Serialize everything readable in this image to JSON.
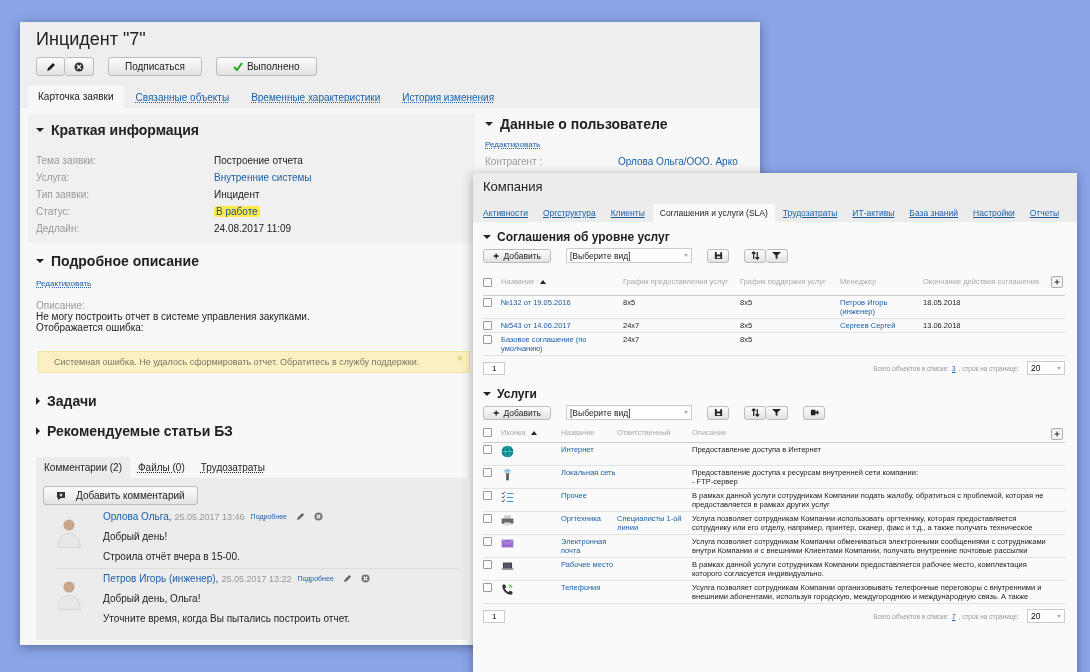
{
  "incident": {
    "title": "Инцидент \"7\"",
    "actions": [
      {
        "label": "Подписаться",
        "kind": "plain"
      },
      {
        "label": "Выполнено",
        "kind": "done"
      }
    ],
    "tabs": [
      {
        "label": "Карточка заявки",
        "selected": true
      },
      {
        "label": "Связанные объекты",
        "selected": false
      },
      {
        "label": "Временные характеристики",
        "selected": false
      },
      {
        "label": "История изменения",
        "selected": false
      }
    ],
    "summary": {
      "title": "Краткая информация",
      "expanded": true,
      "fields": [
        {
          "label": "Тема заявки:",
          "value": "Построение отчета",
          "kind": "text"
        },
        {
          "label": "Услуга:",
          "value": "Внутренние системы",
          "kind": "link"
        },
        {
          "label": "Тип заявки:",
          "value": "Инцидент",
          "kind": "text"
        },
        {
          "label": "Статус:",
          "value": "В работе",
          "kind": "badge"
        },
        {
          "label": "Дедлайн:",
          "value": "24.08.2017 11:09",
          "kind": "text"
        }
      ]
    },
    "user_data": {
      "title": "Данные о пользователе",
      "expanded": true,
      "edit_link": "Редактировать",
      "fields": [
        {
          "label": "Контрагент :",
          "value": "Орлова Ольга/ООО. Арко"
        }
      ]
    },
    "description": {
      "title": "Подробное описание",
      "expanded": true,
      "edit_link": "Редактировать",
      "label": "Описание:",
      "lines": [
        "Не могу построить отчет в системе управления закупками.",
        "Отображается ошибка:"
      ],
      "alert": "Системная ошибка. Не удалось сформировать отчет. Обратитесь в службу поддержки.",
      "alert_close": "×"
    },
    "sections": [
      {
        "title": "Задачи",
        "expanded": false
      },
      {
        "title": "Рекомендуемые статьи БЗ",
        "expanded": false
      }
    ],
    "comment_tabs": [
      {
        "label": "Комментарии (2)",
        "selected": true
      },
      {
        "label": "Файлы (0)",
        "selected": false
      },
      {
        "label": "Трудозатраты",
        "selected": false
      }
    ],
    "add_comment": "Добавить комментарий",
    "comments": [
      {
        "author": "Орлова Ольга,",
        "date": "25.05.2017 13:46",
        "more": "Подробнее",
        "lines": [
          "Добрый день!",
          "Строила отчёт вчера в 15-00."
        ]
      },
      {
        "author": "Петров Игорь (инженер),",
        "date": "25.05.2017 13:22",
        "more": "Подробнее",
        "lines": [
          "Добрый день, Ольга!",
          "Уточните время, когда Вы пытались построить отчет."
        ]
      }
    ]
  },
  "company": {
    "title": "Компания",
    "tabs": [
      {
        "label": "Активности",
        "selected": false
      },
      {
        "label": "Оргструктура",
        "selected": false
      },
      {
        "label": "Клиенты",
        "selected": false
      },
      {
        "label": "Соглашения и услуги (SLA)",
        "selected": true
      },
      {
        "label": "Трудозатраты",
        "selected": false
      },
      {
        "label": "ИТ-активы",
        "selected": false
      },
      {
        "label": "База знаний",
        "selected": false
      },
      {
        "label": "Настройки",
        "selected": false
      },
      {
        "label": "Отчеты",
        "selected": false
      }
    ],
    "sla": {
      "title": "Соглашения об уровне услуг",
      "expanded": true,
      "all_checked": false,
      "add": "Добавить",
      "view": "[Выберите вид]",
      "columns": [
        "Название",
        "График предоставления услуг",
        "График поддержки услуг",
        "Менеджер",
        "Окончание действия соглашения"
      ],
      "rows": [
        {
          "name": "№132 от 19.05.2016",
          "provision": "8x5",
          "support": "8x5",
          "manager": "Петров Игорь (инженер)",
          "end": "18.05.2018",
          "checked": false
        },
        {
          "name": "№543 от 14.06.2017",
          "provision": "24x7",
          "support": "8x5",
          "manager": "Сергеев Сергей",
          "end": "13.06.2018",
          "checked": false
        },
        {
          "name": "Базовое соглашение (по умолчанию)",
          "provision": "24x7",
          "support": "8x5",
          "checked": false
        }
      ],
      "page": "1",
      "total_label": "Всего объектов в списке:",
      "total": "3",
      "per_page_label": ", строк на странице:",
      "per_page": "20"
    },
    "services": {
      "title": "Услуги",
      "expanded": true,
      "all_checked": false,
      "add": "Добавить",
      "view": "[Выберите вид]",
      "columns": [
        "Иконка",
        "Название",
        "Ответственный",
        "Описание"
      ],
      "rows": [
        {
          "kind": "globe",
          "name": "Интернет",
          "lines": [
            "Предоставление доступа в Интернет"
          ],
          "checked": false
        },
        {
          "kind": "signal",
          "name": "Локальная сеть",
          "lines": [
            "Предоставление доступа к ресурсам внутренней сети компании:",
            "- FTP-сервер"
          ],
          "checked": false
        },
        {
          "kind": "checklist",
          "name": "Прочее",
          "lines": [
            "В рамках данной услуги сотрудникам Компании подать жалобу, обратиться с проблемой, которая не",
            "предоставляется в рамках других услуг"
          ],
          "checked": false
        },
        {
          "kind": "printer",
          "name": "Оргтехника",
          "owner": "Специалисты 1-ой линии",
          "lines": [
            "Услуга позволяет сотрудникам Компании использовать оргтехнику, которая предоставляется",
            "сотруднику или его отделу, например, принтер, сканер, факс и т.д., а также получать техническое"
          ],
          "checked": false
        },
        {
          "kind": "mail",
          "name": "Электронная почта",
          "lines": [
            "Услуга позволяет сотрудникам Компании обмениваться электронными сообщениями с сотрудниками",
            "внутри Компании и с внешними Клиентами Компании, получать внутренние почтовые рассылки"
          ],
          "checked": false
        },
        {
          "kind": "laptop",
          "name": "Рабочее место",
          "lines": [
            "В рамках данной услуги сотрудникам Компании предоставляется рабочее место, комплектация",
            "которого согласуется индивидуально."
          ],
          "checked": false
        },
        {
          "kind": "phone",
          "name": "Телефония",
          "lines": [
            "Усулга позволяет сотрудникам Компании организовывать телефонные переговоры с внутренними и",
            "внешними абонентами, используя городскую, междугороднюю и международную связь. А также"
          ],
          "checked": false
        }
      ],
      "page": "1",
      "total_label": "Всего объектов в списке:",
      "total": "7",
      "per_page_label": ", строк на странице:",
      "per_page": "20"
    }
  }
}
